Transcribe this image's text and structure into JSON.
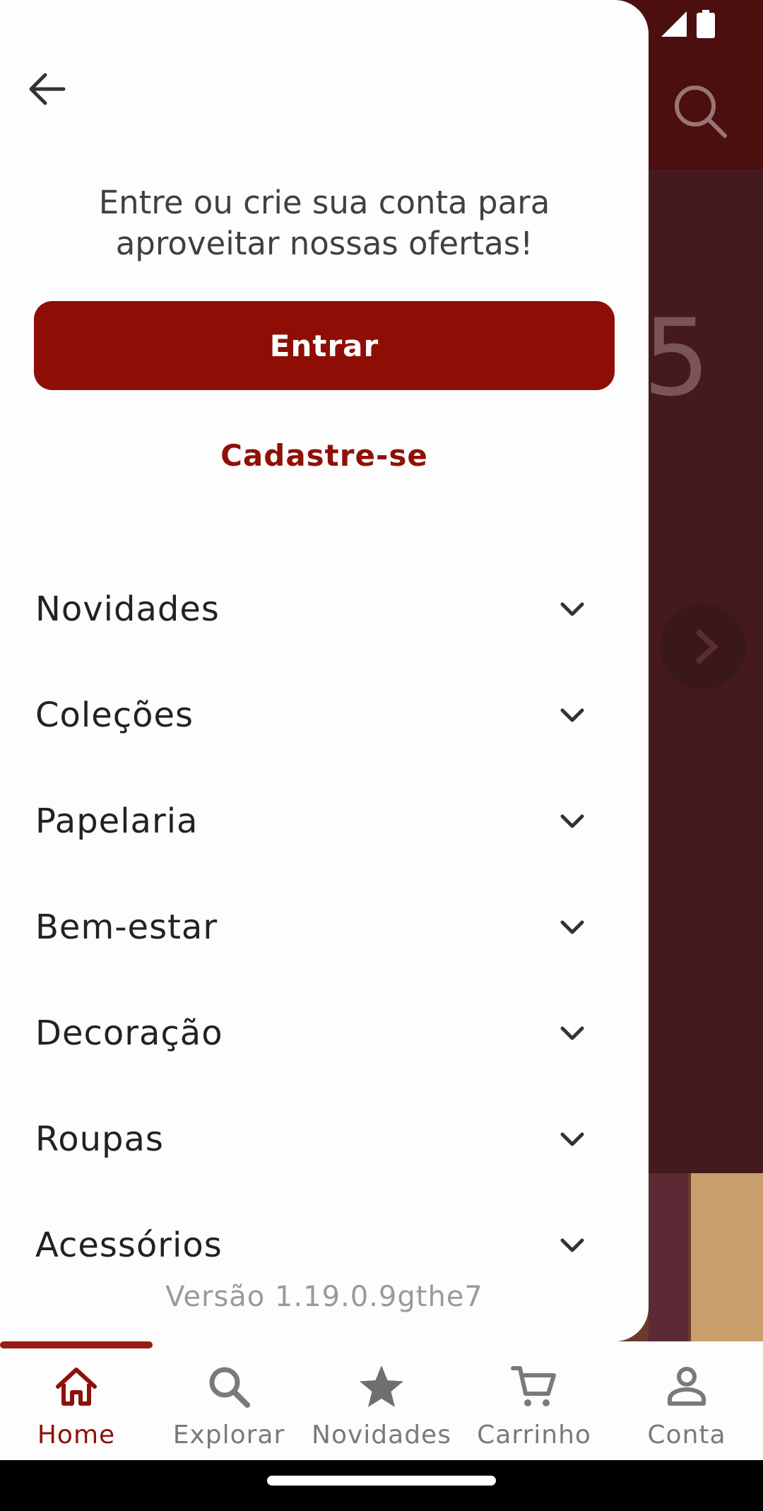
{
  "drawer": {
    "prompt_line1": "Entre ou crie sua conta para",
    "prompt_line2": "aproveitar nossas ofertas!",
    "login_label": "Entrar",
    "signup_label": "Cadastre-se",
    "menu_items": [
      {
        "label": "Novidades",
        "icon": "chevron-down-icon"
      },
      {
        "label": "Coleções",
        "icon": "chevron-down-icon"
      },
      {
        "label": "Papelaria",
        "icon": "chevron-down-icon"
      },
      {
        "label": "Bem-estar",
        "icon": "chevron-down-icon"
      },
      {
        "label": "Decoração",
        "icon": "chevron-down-icon"
      },
      {
        "label": "Roupas",
        "icon": "chevron-down-icon"
      },
      {
        "label": "Acessórios",
        "icon": "chevron-down-icon"
      }
    ],
    "version": "Versão 1.19.0.9gthe7"
  },
  "bottom_nav": {
    "items": [
      {
        "label": "Home",
        "icon": "home-icon",
        "active": true
      },
      {
        "label": "Explorar",
        "icon": "search-icon",
        "active": false
      },
      {
        "label": "Novidades",
        "icon": "star-icon",
        "active": false
      },
      {
        "label": "Carrinho",
        "icon": "cart-icon",
        "active": false
      },
      {
        "label": "Conta",
        "icon": "person-icon",
        "active": false
      }
    ]
  },
  "colors": {
    "brand": "#8e0e05",
    "topbar": "#4b0f10",
    "inactive": "#7a7a7a"
  }
}
